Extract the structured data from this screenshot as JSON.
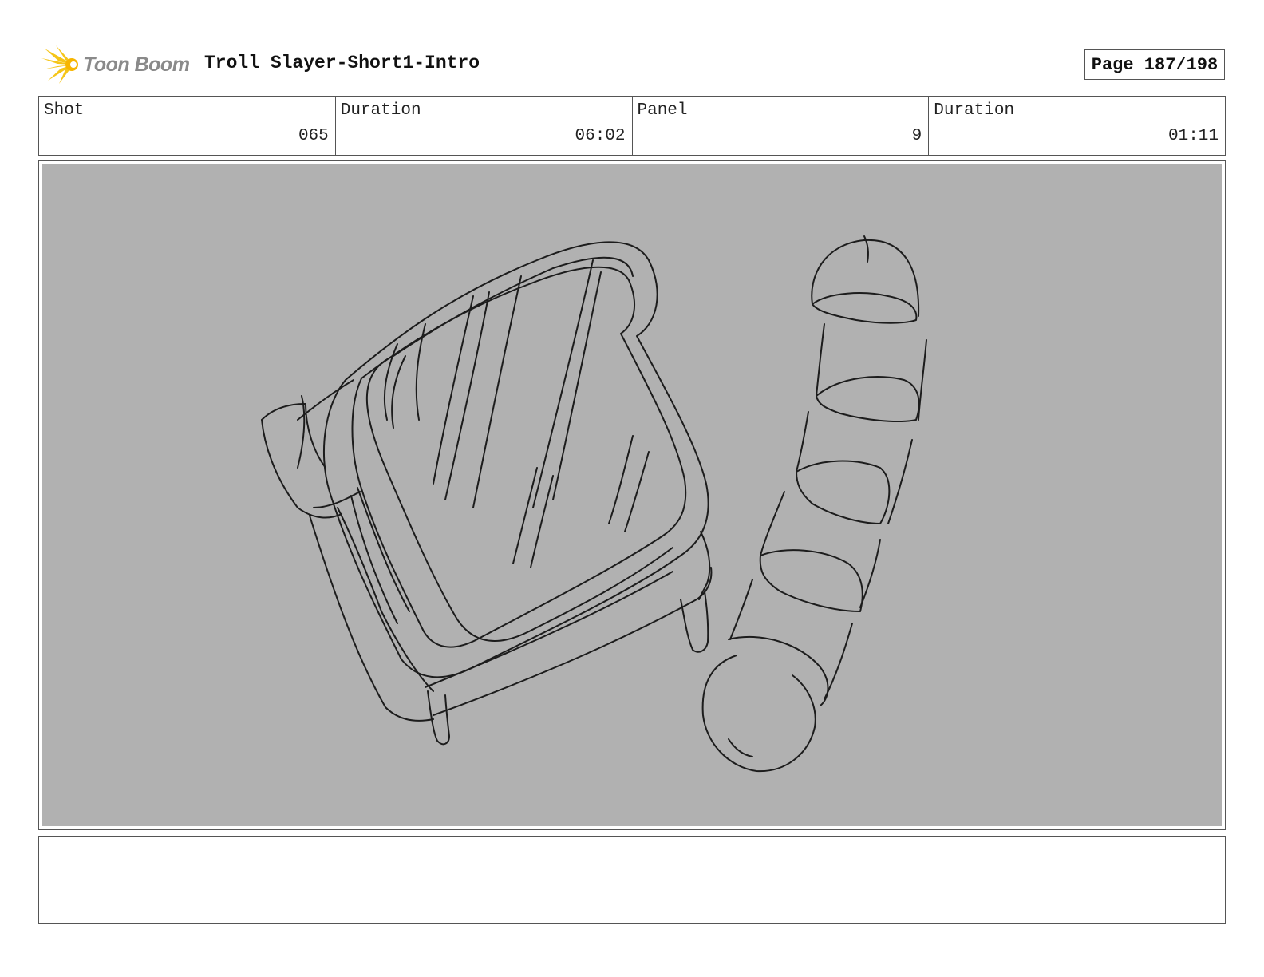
{
  "header": {
    "logo_text": "Toon Boom",
    "project_title": "Troll Slayer-Short1-Intro",
    "page_label": "Page 187/198"
  },
  "info": {
    "shot_label": "Shot",
    "shot_value": "065",
    "shot_duration_label": "Duration",
    "shot_duration_value": "06:02",
    "panel_label": "Panel",
    "panel_value": "9",
    "panel_duration_label": "Duration",
    "panel_duration_value": "01:11"
  },
  "panel": {
    "background_color": "#b1b1b1",
    "sketch_subjects": [
      "bread-slice-sketch",
      "sliced-sausage-sketch"
    ]
  },
  "notes": {
    "text": ""
  },
  "colors": {
    "logo_star": "#f5c518",
    "logo_text": "#8a8a8a",
    "border": "#555555"
  }
}
